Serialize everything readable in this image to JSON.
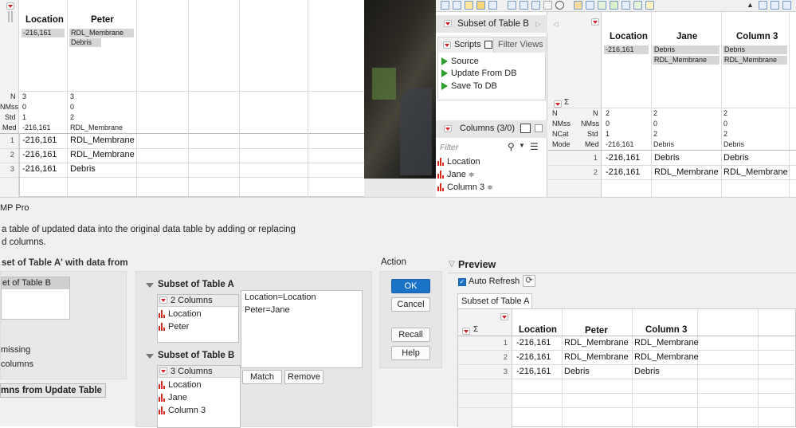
{
  "table_a": {
    "columns": [
      {
        "name": "Location",
        "tags": [
          "-216,161"
        ],
        "n": "3",
        "nmiss": "0",
        "std": "1",
        "med": "-216,161"
      },
      {
        "name": "Peter",
        "tags": [
          "RDL_Membrane",
          "Debris"
        ],
        "n": "3",
        "nmiss": "0",
        "std": "2",
        "med": "RDL_Membrane"
      }
    ],
    "stat_labels": [
      "N",
      "NMss",
      "Std",
      "Med"
    ],
    "rows": [
      {
        "n": "1",
        "cells": [
          "-216,161",
          "RDL_Membrane"
        ]
      },
      {
        "n": "2",
        "cells": [
          "-216,161",
          "RDL_Membrane"
        ]
      },
      {
        "n": "3",
        "cells": [
          "-216,161",
          "Debris"
        ]
      }
    ]
  },
  "table_b_panel": {
    "title": "Subset of Table B",
    "scripts_label": "Scripts",
    "filter_views_label": "Filter Views",
    "scripts": [
      "Source",
      "Update From DB",
      "Save To DB"
    ],
    "columns_header": "Columns (3/0)",
    "filter_placeholder": "Filter",
    "columns": [
      "Location",
      "Jane",
      "Column 3"
    ]
  },
  "table_b": {
    "columns": [
      {
        "name": "Location",
        "tags": [
          "-216,161"
        ],
        "stats": [
          "2",
          "0",
          "1",
          "-216,161"
        ]
      },
      {
        "name": "Jane",
        "tags": [
          "Debris",
          "RDL_Membrane"
        ],
        "stats": [
          "2",
          "0",
          "2",
          "Debris"
        ]
      },
      {
        "name": "Column 3",
        "tags": [
          "Debris",
          "RDL_Membrane"
        ],
        "stats": [
          "2",
          "0",
          "2",
          "Debris"
        ]
      }
    ],
    "stat_left": [
      "N",
      "NMss",
      "NCat",
      "Mode"
    ],
    "stat_right": [
      "N",
      "NMss",
      "Std",
      "Med"
    ],
    "rows": [
      {
        "n": "1",
        "cells": [
          "-216,161",
          "Debris",
          "Debris"
        ]
      },
      {
        "n": "2",
        "cells": [
          "-216,161",
          "RDL_Membrane",
          "RDL_Membrane"
        ]
      }
    ]
  },
  "dialog": {
    "title_fragment": "MP Pro",
    "desc_line1": "a table of updated data into the original data table by adding or replacing",
    "desc_line2": "d columns.",
    "update_label": "set of Table A' with data from",
    "source_selected": "et of Table B",
    "missing_label": "missing",
    "columns_label": "columns",
    "add_columns_label": "mns from Update Table",
    "subset_a_title": "Subset of Table A",
    "subset_a_count": "2 Columns",
    "subset_a_cols": [
      "Location",
      "Peter"
    ],
    "subset_b_title": "Subset of Table B",
    "subset_b_count": "3 Columns",
    "subset_b_cols": [
      "Location",
      "Jane",
      "Column 3"
    ],
    "matches": [
      "Location=Location",
      "Peter=Jane"
    ],
    "match_button": "Match",
    "remove_button": "Remove",
    "action_label": "Action",
    "ok": "OK",
    "cancel": "Cancel",
    "recall": "Recall",
    "help": "Help"
  },
  "preview": {
    "title": "Preview",
    "auto_refresh": "Auto Refresh",
    "tab": "Subset of Table A",
    "columns": [
      "Location",
      "Peter",
      "Column 3"
    ],
    "rows": [
      {
        "n": "1",
        "cells": [
          "-216,161",
          "RDL_Membrane",
          "RDL_Membrane"
        ]
      },
      {
        "n": "2",
        "cells": [
          "-216,161",
          "RDL_Membrane",
          "RDL_Membrane"
        ]
      },
      {
        "n": "3",
        "cells": [
          "-216,161",
          "Debris",
          "Debris"
        ]
      }
    ]
  },
  "colors": {
    "accent": "#1a73c7",
    "bar_icon": "#d42a20",
    "play": "#2e9e2e"
  }
}
